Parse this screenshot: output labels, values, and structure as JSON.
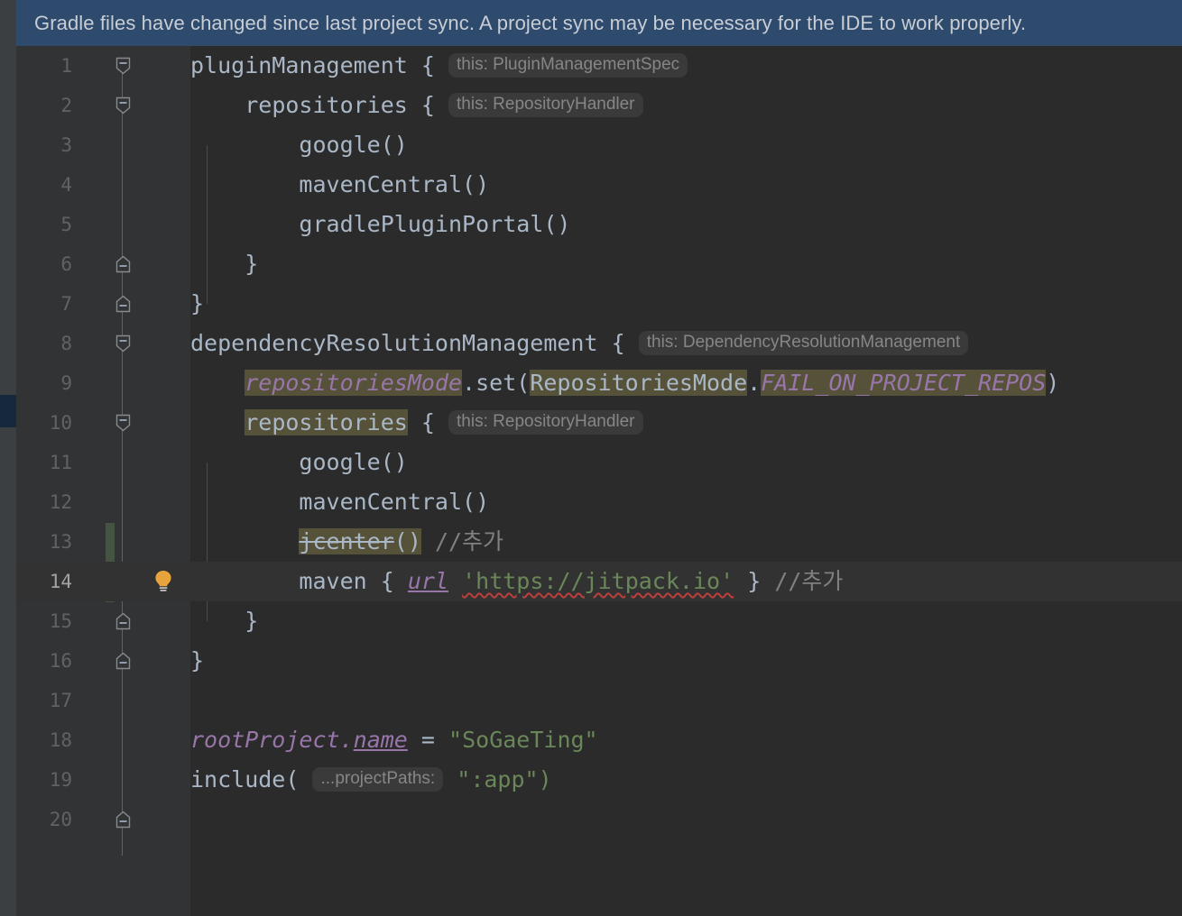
{
  "notification": {
    "text": "Gradle files have changed since last project sync. A project sync may be necessary for the IDE to work properly.",
    "background": "#2e4a6d",
    "text_color": "#c8cdd4"
  },
  "editor": {
    "background": "#2b2b2b",
    "gutter_background": "#313335",
    "current_line": 14,
    "current_line_background": "#323232",
    "change_marker_color": "#455442",
    "usage_highlight_color": "#56523a",
    "line_height": 44,
    "font_size": 25,
    "colors": {
      "default_text": "#a9b7c6",
      "string": "#6a8759",
      "comment": "#808080",
      "identifier_purple": "#9876aa",
      "inlay_text": "#868686",
      "inlay_background": "#3a3a3a",
      "line_number": "#606366",
      "current_line_number": "#a4a3a3",
      "error_squiggle": "#bc3f3c",
      "bulb": "#e8a33d"
    },
    "lines": [
      {
        "num": 1,
        "text": "pluginManagement {"
      },
      {
        "num": 2,
        "text": "    repositories {"
      },
      {
        "num": 3,
        "text": "        google()"
      },
      {
        "num": 4,
        "text": "        mavenCentral()"
      },
      {
        "num": 5,
        "text": "        gradlePluginPortal()"
      },
      {
        "num": 6,
        "text": "    }"
      },
      {
        "num": 7,
        "text": "}"
      },
      {
        "num": 8,
        "text": "dependencyResolutionManagement {"
      },
      {
        "num": 9,
        "text": "    repositoriesMode.set(RepositoriesMode.FAIL_ON_PROJECT_REPOS)"
      },
      {
        "num": 10,
        "text": "    repositories {"
      },
      {
        "num": 11,
        "text": "        google()"
      },
      {
        "num": 12,
        "text": "        mavenCentral()"
      },
      {
        "num": 13,
        "text": "        jcenter() //추가"
      },
      {
        "num": 14,
        "text": "        maven { url 'https://jitpack.io' } //추가"
      },
      {
        "num": 15,
        "text": "    }"
      },
      {
        "num": 16,
        "text": "}"
      },
      {
        "num": 17,
        "text": ""
      },
      {
        "num": 18,
        "text": "rootProject.name = \"SoGaeTing\""
      },
      {
        "num": 19,
        "text": "include(\":app\")"
      },
      {
        "num": 20,
        "text": ""
      }
    ],
    "tokens": {
      "plugin_management": "pluginManagement",
      "repositories": "repositories",
      "google": "google()",
      "maven_central": "mavenCentral()",
      "gradle_plugin_portal": "gradlePluginPortal()",
      "dependency_resolution_management": "dependencyResolutionManagement",
      "repositories_mode_lower": "repositoriesMode",
      "dot_set_open": ".set(",
      "repositories_mode_upper": "RepositoriesMode",
      "dot": ".",
      "fail_on_project_repos": "FAIL_ON_PROJECT_REPOS",
      "close_paren": ")",
      "jcenter_name": "jcenter",
      "jcenter_parens": "()",
      "comment_add": "//추가",
      "maven": "maven",
      "brace_open": "{",
      "brace_close": "}",
      "url_keyword": "url",
      "jitpack_url": "'https://jitpack.io'",
      "root_project": "rootProject",
      "name_field": "name",
      "equals": "=",
      "project_name": "\"SoGaeTing\"",
      "include_open": "include(",
      "app_module": "\":app\")"
    },
    "inlay_hints": {
      "plugin_management_spec": "this: PluginManagementSpec",
      "repository_handler": "this: RepositoryHandler",
      "dependency_resolution_management": "this: DependencyResolutionManagement",
      "repository_handler_2": "this: RepositoryHandler",
      "project_paths": "...projectPaths:"
    },
    "gutter": {
      "fold_markers_open": [
        1,
        2,
        8,
        10
      ],
      "fold_markers_close": [
        6,
        7,
        15,
        16,
        20
      ],
      "bulb_line": 14,
      "change_bar_lines": [
        13,
        14
      ]
    }
  },
  "left_strip": {
    "background": "#3c3f41",
    "marker_color": "#16283d"
  }
}
